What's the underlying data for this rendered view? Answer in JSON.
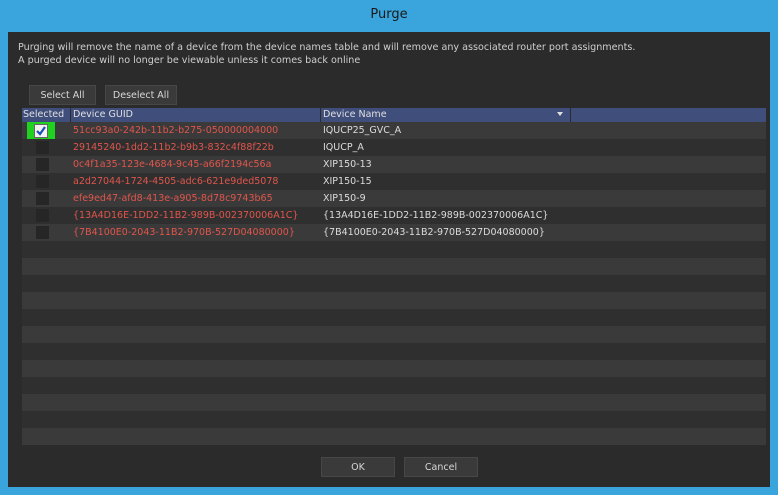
{
  "window": {
    "title": "Purge"
  },
  "description": {
    "line1": "Purging will remove the name of a device from the device names table and will remove any associated router port assignments.",
    "line2": "A purged device will no longer be viewable unless it comes back online"
  },
  "buttons": {
    "select_all": "Select All",
    "deselect_all": "Deselect All",
    "ok": "OK",
    "cancel": "Cancel"
  },
  "table": {
    "columns": [
      "Selected",
      "Device GUID",
      "Device Name"
    ],
    "rows": [
      {
        "selected": true,
        "guid": "51cc93a0-242b-11b2-b275-050000004000",
        "name": "IQUCP25_GVC_A"
      },
      {
        "selected": false,
        "guid": "29145240-1dd2-11b2-b9b3-832c4f88f22b",
        "name": "IQUCP_A"
      },
      {
        "selected": false,
        "guid": "0c4f1a35-123e-4684-9c45-a66f2194c56a",
        "name": "XIP150-13"
      },
      {
        "selected": false,
        "guid": "a2d27044-1724-4505-adc6-621e9ded5078",
        "name": "XIP150-15"
      },
      {
        "selected": false,
        "guid": "efe9ed47-afd8-413e-a905-8d78c9743b65",
        "name": "XIP150-9"
      },
      {
        "selected": false,
        "guid": "{13A4D16E-1DD2-11B2-989B-002370006A1C}",
        "name": "{13A4D16E-1DD2-11B2-989B-002370006A1C}"
      },
      {
        "selected": false,
        "guid": "{7B4100E0-2043-11B2-970B-527D04080000}",
        "name": "{7B4100E0-2043-11B2-970B-527D04080000}"
      }
    ]
  },
  "colors": {
    "title_bar": "#3aa5dd",
    "guid_text": "#e0564c",
    "header_bg": "#3f4e7b",
    "highlight": "#1fd21f"
  }
}
